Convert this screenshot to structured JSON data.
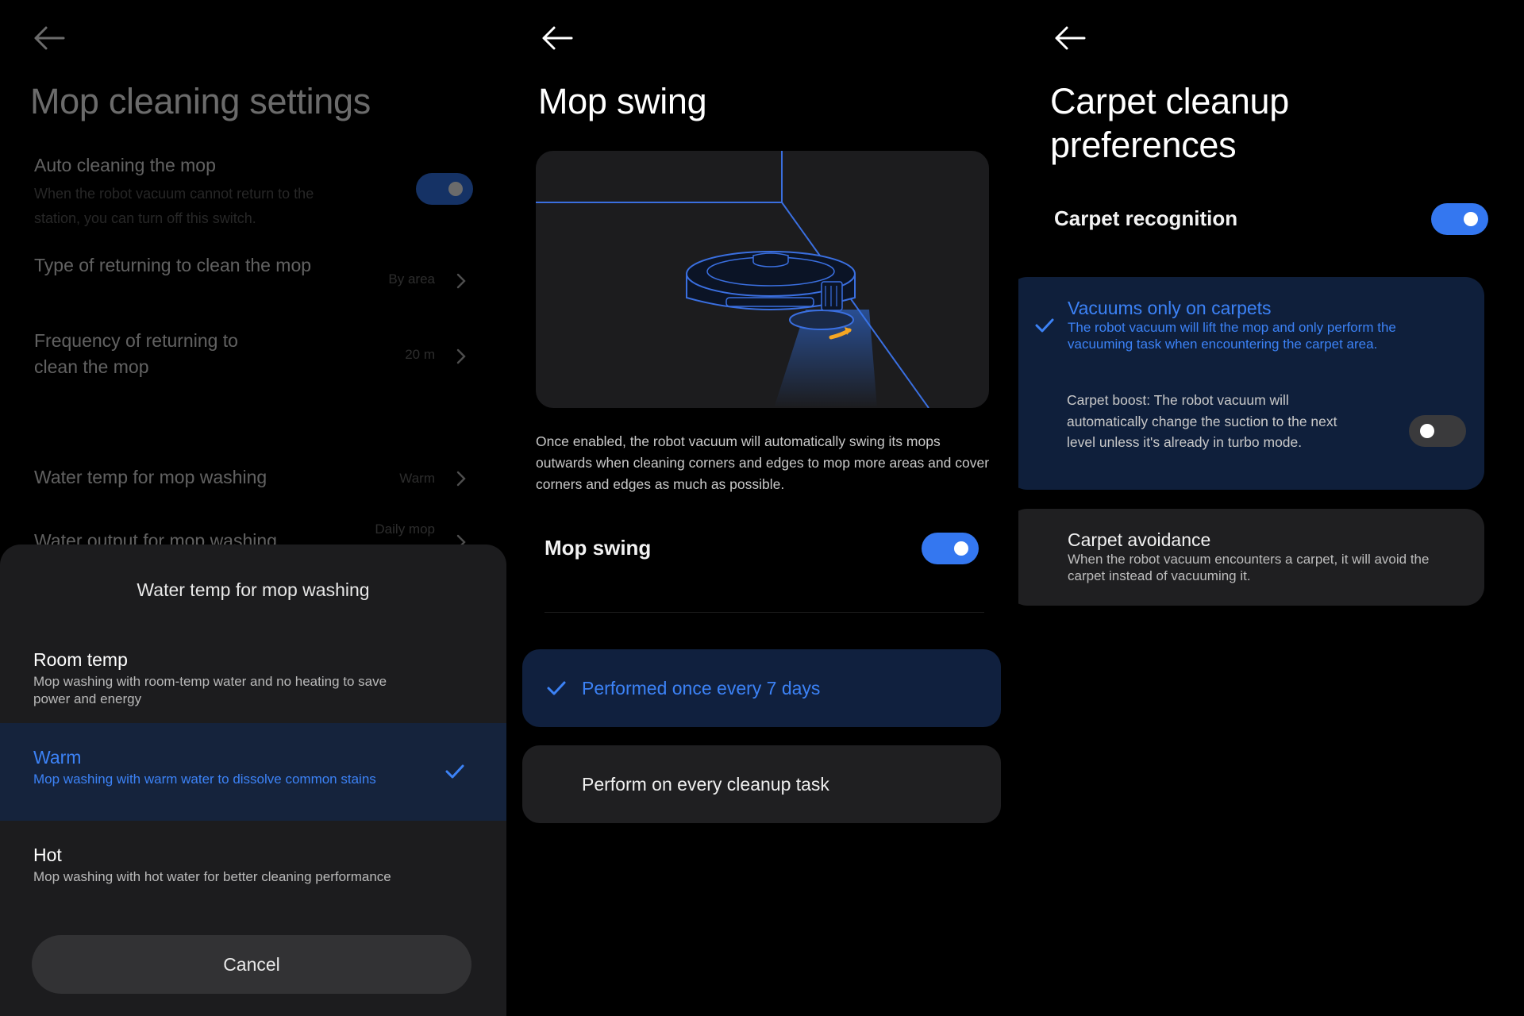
{
  "panel1": {
    "title": "Mop cleaning settings",
    "rows": [
      {
        "title": "Auto cleaning the mop",
        "desc": "When the robot vacuum cannot return to the station, you can turn off this switch.",
        "toggle": "on"
      },
      {
        "title": "Type of returning to clean the mop",
        "value": "By area"
      },
      {
        "title": "Frequency of returning to clean the mop",
        "value": "20 m"
      },
      {
        "title": "Water temp for mop washing",
        "value": "Warm"
      },
      {
        "title": "Water output for mop washing",
        "value": "Daily mop"
      }
    ],
    "sheet": {
      "title": "Water temp for mop washing",
      "options": [
        {
          "title": "Room temp",
          "desc": "Mop washing with room-temp water and no heating to save power and energy"
        },
        {
          "title": "Warm",
          "desc": "Mop washing with warm water to dissolve common stains",
          "selected": true
        },
        {
          "title": "Hot",
          "desc": "Mop washing with hot water for better cleaning performance"
        }
      ],
      "cancel": "Cancel"
    }
  },
  "panel2": {
    "title": "Mop swing",
    "description": "Once enabled, the robot vacuum will automatically swing its mops outwards when cleaning corners and edges to mop more areas and cover corners and edges as much as possible.",
    "setting_label": "Mop swing",
    "setting_toggle": "on",
    "choices": [
      {
        "label": "Performed once every 7 days",
        "selected": true
      },
      {
        "label": "Perform on every cleanup task",
        "selected": false
      }
    ]
  },
  "panel3": {
    "title_line1": "Carpet cleanup",
    "title_line2": "preferences",
    "recognition_label": "Carpet recognition",
    "recognition_toggle": "on",
    "vacuum_only": {
      "title": "Vacuums only on carpets",
      "desc": "The robot vacuum will lift the mop and only perform the vacuuming task when encountering the carpet area.",
      "selected": true
    },
    "boost": {
      "text": "Carpet boost: The robot vacuum will automatically change the suction to the next level unless it's already in turbo mode.",
      "toggle": "off"
    },
    "avoidance": {
      "title": "Carpet avoidance",
      "desc": "When the robot vacuum encounters a carpet, it will avoid the carpet instead of vacuuming it."
    }
  },
  "colors": {
    "accent_blue": "#3477f0",
    "selected_text_blue": "#3c82f6",
    "selected_bg": "#10203e",
    "sheet_bg": "#1c1c1e"
  },
  "icons": [
    "back-arrow-icon",
    "chevron-right-icon",
    "check-icon"
  ]
}
